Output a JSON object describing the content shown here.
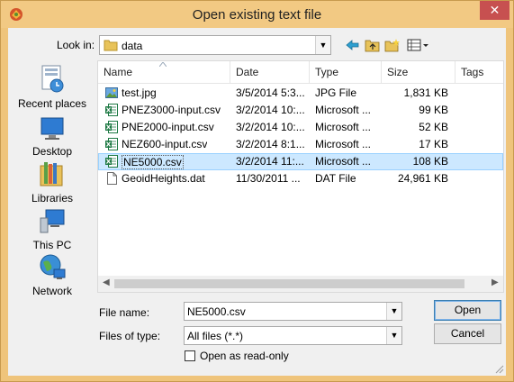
{
  "window": {
    "title": "Open existing text file",
    "close_glyph": "✕"
  },
  "lookin": {
    "label": "Look in:",
    "value": "data"
  },
  "places": [
    {
      "label": "Recent places",
      "icon": "recent-places-icon"
    },
    {
      "label": "Desktop",
      "icon": "desktop-icon"
    },
    {
      "label": "Libraries",
      "icon": "libraries-icon"
    },
    {
      "label": "This PC",
      "icon": "this-pc-icon"
    },
    {
      "label": "Network",
      "icon": "network-icon"
    }
  ],
  "columns": [
    "Name",
    "Date",
    "Type",
    "Size",
    "Tags"
  ],
  "files": [
    {
      "name": "test.jpg",
      "date": "3/5/2014 5:3...",
      "type": "JPG File",
      "size": "1,831 KB",
      "icon": "image-file-icon"
    },
    {
      "name": "PNEZ3000-input.csv",
      "date": "3/2/2014 10:...",
      "type": "Microsoft ...",
      "size": "99 KB",
      "icon": "excel-file-icon"
    },
    {
      "name": "PNE2000-input.csv",
      "date": "3/2/2014 10:...",
      "type": "Microsoft ...",
      "size": "52 KB",
      "icon": "excel-file-icon"
    },
    {
      "name": "NEZ600-input.csv",
      "date": "3/2/2014 8:1...",
      "type": "Microsoft ...",
      "size": "17 KB",
      "icon": "excel-file-icon"
    },
    {
      "name": "NE5000.csv",
      "date": "3/2/2014 11:...",
      "type": "Microsoft ...",
      "size": "108 KB",
      "icon": "excel-file-icon",
      "selected": true
    },
    {
      "name": "GeoidHeights.dat",
      "date": "11/30/2011 ...",
      "type": "DAT File",
      "size": "24,961 KB",
      "icon": "generic-file-icon"
    }
  ],
  "filename": {
    "label": "File name:",
    "value": "NE5000.csv"
  },
  "filetype": {
    "label": "Files of type:",
    "value": "All files (*.*)"
  },
  "readonly": {
    "label": "Open as read-only"
  },
  "buttons": {
    "open": "Open",
    "cancel": "Cancel"
  },
  "colors": {
    "titlebar": "#f2c983",
    "selection": "#cce8ff",
    "close": "#c75050"
  }
}
